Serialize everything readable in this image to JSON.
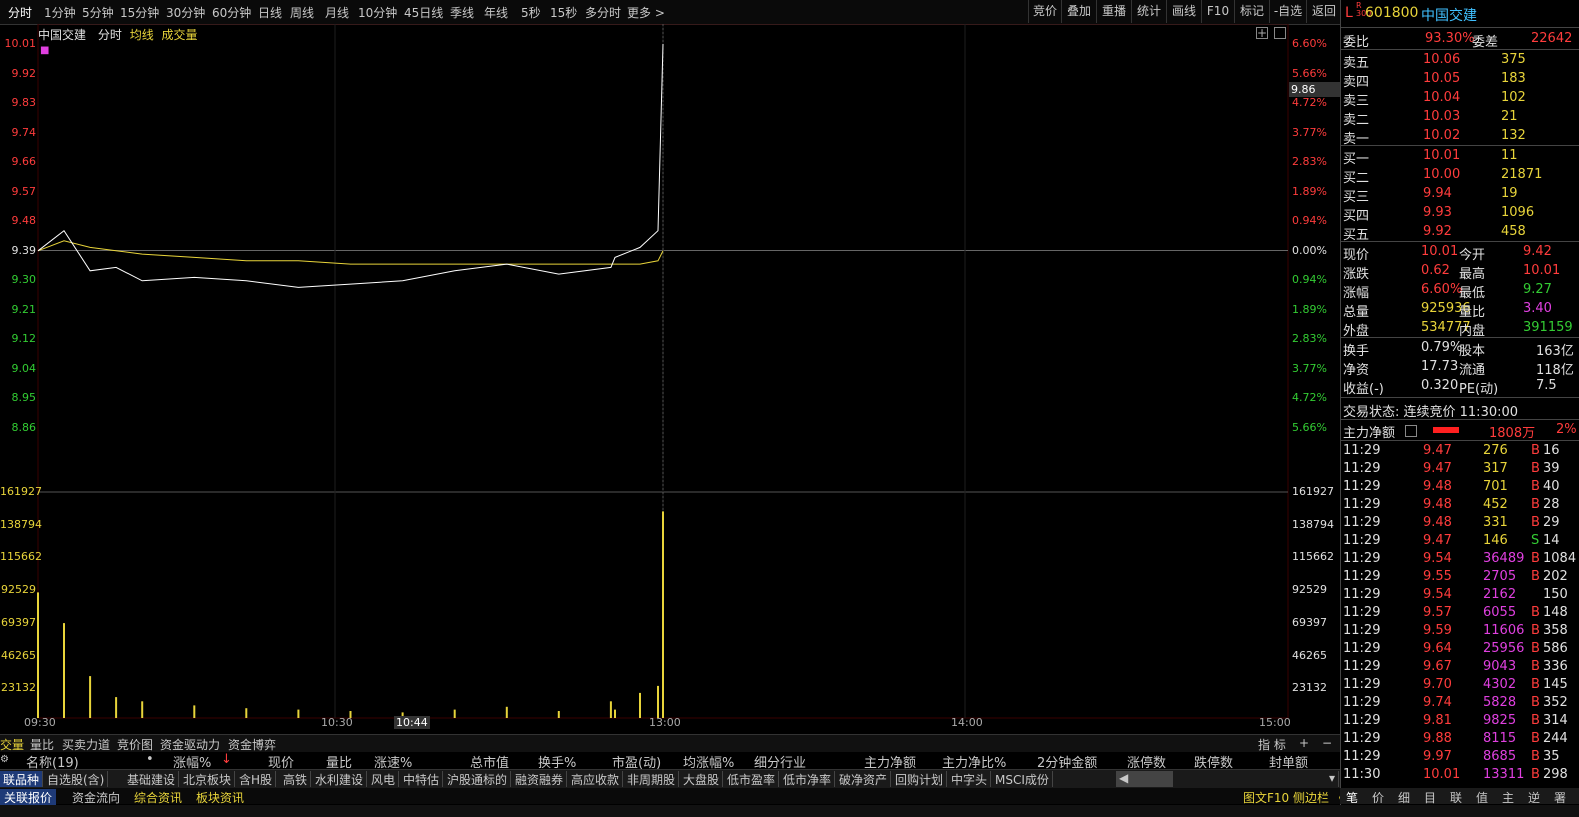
{
  "toolbar": {
    "timeframes": [
      "分时",
      "1分钟",
      "5分钟",
      "15分钟",
      "30分钟",
      "60分钟",
      "日线",
      "周线",
      "月线",
      "10分钟",
      "45日线",
      "季线",
      "年线",
      "5秒",
      "15秒",
      "多分时",
      "更多 >"
    ],
    "right_buttons": [
      "竞价",
      "叠加",
      "重播",
      "统计",
      "画线",
      "F10",
      "标记",
      "-自选",
      "返回"
    ]
  },
  "chart": {
    "stock_name": "中国交建",
    "mode": "分时",
    "avg_label": "均线",
    "vol_label": "成交量",
    "price_axis": [
      "10.01",
      "9.92",
      "9.83",
      "9.74",
      "9.66",
      "9.57",
      "9.48",
      "9.39",
      "9.30",
      "9.21",
      "9.12",
      "9.04",
      "8.95",
      "8.86"
    ],
    "pct_axis": [
      "6.60%",
      "5.66%",
      "4.72%",
      "3.77%",
      "2.83%",
      "1.89%",
      "0.94%",
      "0.00%",
      "0.94%",
      "1.89%",
      "2.83%",
      "3.77%",
      "4.72%",
      "5.66%"
    ],
    "vol_axis": [
      "161927",
      "138794",
      "115662",
      "92529",
      "69397",
      "46265",
      "23132"
    ],
    "vol_axis_left": [
      "161927",
      "138794",
      "115662",
      "92529",
      "69397",
      "46265",
      "23132"
    ],
    "time_axis": [
      "09:30",
      "10:30",
      "10:44",
      "13:00",
      "14:00",
      "15:00"
    ],
    "cursor_price": "9.86"
  },
  "chart_data": {
    "type": "line",
    "title": "中国交建",
    "x": [
      "09:30",
      "09:35",
      "09:40",
      "09:45",
      "09:50",
      "10:00",
      "10:10",
      "10:20",
      "10:30",
      "10:40",
      "10:50",
      "11:00",
      "11:10",
      "11:20",
      "11:25",
      "11:28",
      "11:29",
      "11:30"
    ],
    "series": [
      {
        "name": "分时",
        "values": [
          9.39,
          9.45,
          9.33,
          9.34,
          9.3,
          9.31,
          9.3,
          9.28,
          9.29,
          9.3,
          9.33,
          9.35,
          9.32,
          9.34,
          9.37,
          9.4,
          9.45,
          10.01
        ]
      },
      {
        "name": "均线",
        "values": [
          9.39,
          9.42,
          9.4,
          9.39,
          9.38,
          9.37,
          9.36,
          9.36,
          9.35,
          9.35,
          9.35,
          9.35,
          9.35,
          9.35,
          9.35,
          9.35,
          9.36,
          9.39
        ]
      }
    ],
    "volume": [
      90000,
      68000,
      30000,
      15000,
      12000,
      9000,
      7000,
      6000,
      5000,
      4000,
      6000,
      8000,
      5000,
      12000,
      6000,
      18000,
      23000,
      148000
    ],
    "ylim": [
      8.86,
      10.01
    ],
    "prev_close": 9.39,
    "vol_ylim": [
      0,
      161927
    ]
  },
  "quote": {
    "code": "601800",
    "name": "中国交建",
    "webi_label": "委比",
    "webi": "93.30%",
    "wecha_label": "委差",
    "wecha": "22642",
    "sell": [
      {
        "label": "卖五",
        "price": "10.06",
        "vol": "375"
      },
      {
        "label": "卖四",
        "price": "10.05",
        "vol": "183"
      },
      {
        "label": "卖三",
        "price": "10.04",
        "vol": "102"
      },
      {
        "label": "卖二",
        "price": "10.03",
        "vol": "21"
      },
      {
        "label": "卖一",
        "price": "10.02",
        "vol": "132"
      }
    ],
    "buy": [
      {
        "label": "买一",
        "price": "10.01",
        "vol": "11"
      },
      {
        "label": "买二",
        "price": "10.00",
        "vol": "21871"
      },
      {
        "label": "买三",
        "price": "9.94",
        "vol": "19"
      },
      {
        "label": "买四",
        "price": "9.93",
        "vol": "1096"
      },
      {
        "label": "买五",
        "price": "9.92",
        "vol": "458"
      }
    ],
    "stats": [
      {
        "l1": "现价",
        "v1": "10.01",
        "l2": "今开",
        "v2": "9.42"
      },
      {
        "l1": "涨跌",
        "v1": "0.62",
        "l2": "最高",
        "v2": "10.01"
      },
      {
        "l1": "涨幅",
        "v1": "6.60%",
        "l2": "最低",
        "v2": "9.27"
      },
      {
        "l1": "总量",
        "v1": "925936",
        "l2": "量比",
        "v2": "3.40"
      },
      {
        "l1": "外盘",
        "v1": "534777",
        "l2": "内盘",
        "v2": "391159"
      }
    ],
    "fund": [
      {
        "l1": "换手",
        "v1": "0.79%",
        "l2": "股本",
        "v2": "163亿"
      },
      {
        "l1": "净资",
        "v1": "17.73",
        "l2": "流通",
        "v2": "118亿"
      },
      {
        "l1": "收益(-)",
        "v1": "0.320",
        "l2": "PE(动)",
        "v2": "7.5"
      }
    ],
    "trade_status": "交易状态: 连续竞价 11:30:00",
    "main_net_label": "主力净额",
    "main_net_value": "1808万",
    "main_net_pct": "2%"
  },
  "ticks": [
    {
      "t": "11:29",
      "p": "9.47",
      "v": "276",
      "s": "B",
      "n": "16"
    },
    {
      "t": "11:29",
      "p": "9.47",
      "v": "317",
      "s": "B",
      "n": "39"
    },
    {
      "t": "11:29",
      "p": "9.48",
      "v": "701",
      "s": "B",
      "n": "40"
    },
    {
      "t": "11:29",
      "p": "9.48",
      "v": "452",
      "s": "B",
      "n": "28"
    },
    {
      "t": "11:29",
      "p": "9.48",
      "v": "331",
      "s": "B",
      "n": "29"
    },
    {
      "t": "11:29",
      "p": "9.47",
      "v": "146",
      "s": "S",
      "n": "14"
    },
    {
      "t": "11:29",
      "p": "9.54",
      "v": "36489",
      "s": "B",
      "n": "1084"
    },
    {
      "t": "11:29",
      "p": "9.55",
      "v": "2705",
      "s": "B",
      "n": "202"
    },
    {
      "t": "11:29",
      "p": "9.54",
      "v": "2162",
      "s": "",
      "n": "150"
    },
    {
      "t": "11:29",
      "p": "9.57",
      "v": "6055",
      "s": "B",
      "n": "148"
    },
    {
      "t": "11:29",
      "p": "9.59",
      "v": "11606",
      "s": "B",
      "n": "358"
    },
    {
      "t": "11:29",
      "p": "9.64",
      "v": "25956",
      "s": "B",
      "n": "586"
    },
    {
      "t": "11:29",
      "p": "9.67",
      "v": "9043",
      "s": "B",
      "n": "336"
    },
    {
      "t": "11:29",
      "p": "9.70",
      "v": "4302",
      "s": "B",
      "n": "145"
    },
    {
      "t": "11:29",
      "p": "9.74",
      "v": "5828",
      "s": "B",
      "n": "352"
    },
    {
      "t": "11:29",
      "p": "9.81",
      "v": "9825",
      "s": "B",
      "n": "314"
    },
    {
      "t": "11:29",
      "p": "9.88",
      "v": "8115",
      "s": "B",
      "n": "244"
    },
    {
      "t": "11:29",
      "p": "9.97",
      "v": "8685",
      "s": "B",
      "n": "35"
    },
    {
      "t": "11:30",
      "p": "10.01",
      "v": "13311",
      "s": "B",
      "n": "298"
    }
  ],
  "tabs1": [
    "交量",
    "量比",
    "买卖力道",
    "竞价图",
    "资金驱动力",
    "资金博弈"
  ],
  "tabs1_right": [
    "指 标",
    "+",
    "−"
  ],
  "headers": [
    "名称(19)",
    "•",
    "涨幅%",
    "现价",
    "量比",
    "涨速%",
    "总市值",
    "换手%",
    "市盈(动)",
    "均涨幅%",
    "细分行业",
    "主力净额",
    "主力净比%",
    "2分钟金额",
    "涨停数",
    "跌停数",
    "封单额"
  ],
  "tabs2": [
    "联品种",
    "自选股(含)",
    "基础建设",
    "北京板块",
    "含H股",
    "高铁",
    "水利建设",
    "风电",
    "中特估",
    "沪股通标的",
    "融资融券",
    "高应收款",
    "非周期股",
    "大盘股",
    "低市盈率",
    "低市净率",
    "破净资产",
    "回购计划",
    "中字头",
    "MSCI成份"
  ],
  "tabs3": [
    "关联报价",
    "资金流向",
    "综合资讯",
    "板块资讯"
  ],
  "tabs3_right": "图文F10 侧边栏 《",
  "rbottom": [
    "笔",
    "价",
    "细",
    "目",
    "联",
    "值",
    "主",
    "逆",
    "署"
  ]
}
